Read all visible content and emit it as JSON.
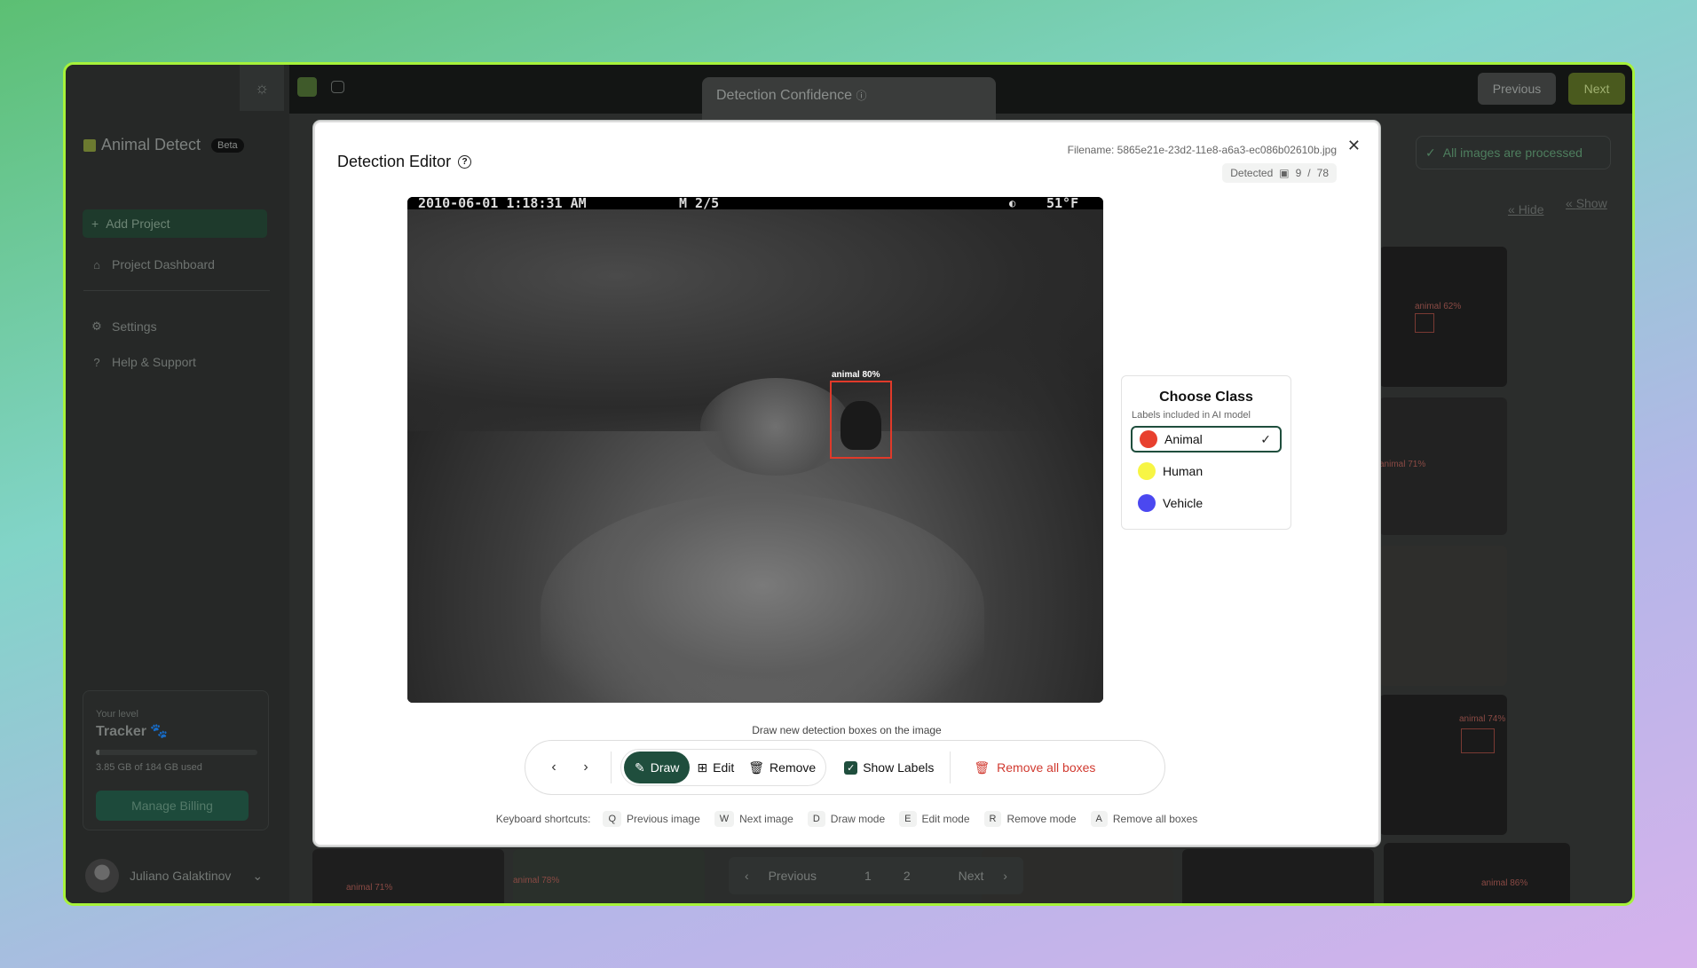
{
  "sidebar": {
    "brand": "Animal Detect",
    "beta": "Beta",
    "add_project": "Add Project",
    "dashboard": "Project Dashboard",
    "settings": "Settings",
    "help": "Help & Support",
    "level_label": "Your level",
    "level_name": "Tracker 🐾",
    "storage_used_fraction": 0.021,
    "storage_text": "3.85 GB of 184 GB used",
    "billing": "Manage Billing",
    "user_name": "Juliano Galaktinov"
  },
  "topbar": {
    "confidence_title": "Detection Confidence",
    "prev": "Previous",
    "next": "Next"
  },
  "main": {
    "processed": "All images are processed",
    "hide": "Hide",
    "show": "Show",
    "thumb_labels": [
      "animal 62%",
      "animal 71%",
      "animal 74%",
      "animal 86%",
      "animal 71%",
      "animal 78%"
    ],
    "pager_prev": "Previous",
    "pager_1": "1",
    "pager_2": "2",
    "pager_next": "Next"
  },
  "modal": {
    "title": "Detection Editor",
    "filename": "Filename: 5865e21e-23d2-11e8-a6a3-ec086b02610b.jpg",
    "detected_label": "Detected",
    "detected_current": "9",
    "detected_sep": "/",
    "detected_total": "78",
    "stamp_date": "2010-06-01 1:18:31 AM",
    "stamp_cam": "M 2/5",
    "stamp_temp": "51°F",
    "detection_label": "animal 80%",
    "class_panel": {
      "title": "Choose Class",
      "subtitle": "Labels included in AI model",
      "classes": [
        {
          "name": "Animal",
          "color": "#e8402e",
          "selected": true
        },
        {
          "name": "Human",
          "color": "#f7f544",
          "selected": false
        },
        {
          "name": "Vehicle",
          "color": "#4b48f0",
          "selected": false
        }
      ]
    },
    "hint": "Draw new detection boxes on the image",
    "tools": {
      "draw": "Draw",
      "edit": "Edit",
      "remove": "Remove",
      "show_labels": "Show Labels",
      "remove_all": "Remove all boxes"
    },
    "shortcuts_label": "Keyboard shortcuts:",
    "shortcuts": [
      {
        "key": "Q",
        "action": "Previous image"
      },
      {
        "key": "W",
        "action": "Next image"
      },
      {
        "key": "D",
        "action": "Draw mode"
      },
      {
        "key": "E",
        "action": "Edit mode"
      },
      {
        "key": "R",
        "action": "Remove mode"
      },
      {
        "key": "A",
        "action": "Remove all boxes"
      }
    ]
  }
}
